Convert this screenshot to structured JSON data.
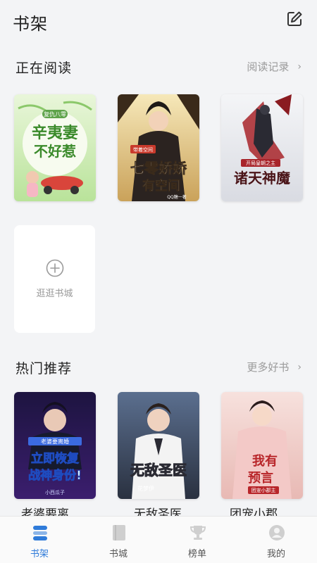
{
  "header": {
    "title": "书架",
    "edit_icon": "edit-icon"
  },
  "reading": {
    "label": "正在阅读",
    "more_label": "阅读记录",
    "books": [
      {
        "cover_text": "辛夷妻不好惹",
        "badge": "复仇八零"
      },
      {
        "cover_text": "七零娇娇有空间",
        "badge": "带着空间",
        "author": "QQ糖一著"
      },
      {
        "cover_text": "诸天神魔",
        "badge": "开局皇朝之主"
      }
    ],
    "add_label": "逛逛书城"
  },
  "recommend": {
    "label": "热门推荐",
    "more_label": "更多好书",
    "books": [
      {
        "title": "老婆要离",
        "cover_text": "立即恢复战神身份!",
        "badge": "老婆要离婚",
        "author": "小西瓜子"
      },
      {
        "title": "无敌圣医",
        "cover_text": "无敌圣医",
        "author": "花梦伊"
      },
      {
        "title": "团宠小郡",
        "cover_text": "我有预言",
        "badge": "团宠小郡主"
      }
    ]
  },
  "tabbar": {
    "tabs": [
      {
        "label": "书架",
        "icon": "bookshelf-icon",
        "active": true
      },
      {
        "label": "书城",
        "icon": "book-icon",
        "active": false
      },
      {
        "label": "榜单",
        "icon": "trophy-icon",
        "active": false
      },
      {
        "label": "我的",
        "icon": "profile-icon",
        "active": false
      }
    ]
  },
  "colors": {
    "accent": "#2f7bd9",
    "background": "#f3f4f6"
  }
}
